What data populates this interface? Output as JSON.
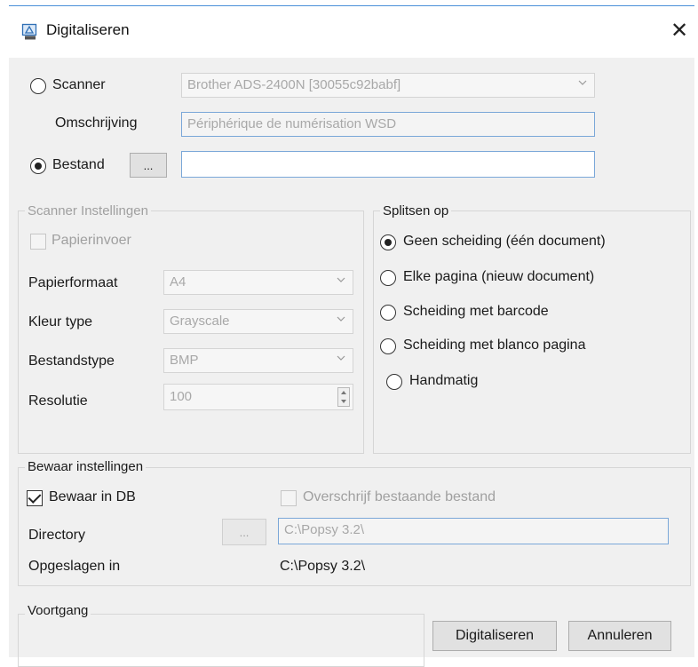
{
  "window": {
    "title": "Digitaliseren",
    "icon": "scanner-document-icon",
    "close_glyph": "✕",
    "accent": "#4a90d9"
  },
  "source": {
    "scanner_label": "Scanner",
    "scanner_selected": false,
    "scanner_value": "Brother ADS-2400N [30055c92babf]",
    "description_label": "Omschrijving",
    "description_value": "Périphérique de numérisation WSD",
    "file_label": "Bestand",
    "file_selected": true,
    "browse_label": "...",
    "file_value": ""
  },
  "scanner_settings": {
    "title": "Scanner Instellingen",
    "feeder_label": "Papierinvoer",
    "paper_size_label": "Papierformaat",
    "paper_size_value": "A4",
    "color_type_label": "Kleur type",
    "color_type_value": "Grayscale",
    "file_type_label": "Bestandstype",
    "file_type_value": "BMP",
    "resolution_label": "Resolutie",
    "resolution_value": "100"
  },
  "split": {
    "title": "Splitsen op",
    "options": [
      {
        "label": "Geen scheiding (één document)",
        "checked": true
      },
      {
        "label": "Elke pagina (nieuw document)",
        "checked": false
      },
      {
        "label": "Scheiding met barcode",
        "checked": false
      },
      {
        "label": "Scheiding met blanco pagina",
        "checked": false
      },
      {
        "label": "Handmatig",
        "checked": false
      }
    ]
  },
  "save_settings": {
    "title": "Bewaar instellingen",
    "save_in_db_label": "Bewaar in DB",
    "save_in_db_checked": true,
    "overwrite_label": "Overschrijf bestaande bestand",
    "directory_label": "Directory",
    "browse_label": "...",
    "directory_value": "C:\\Popsy 3.2\\",
    "saved_in_label": "Opgeslagen in",
    "saved_in_value": "C:\\Popsy 3.2\\"
  },
  "progress": {
    "title": "Voortgang"
  },
  "actions": {
    "digitize_label": "Digitaliseren",
    "cancel_label": "Annuleren"
  }
}
